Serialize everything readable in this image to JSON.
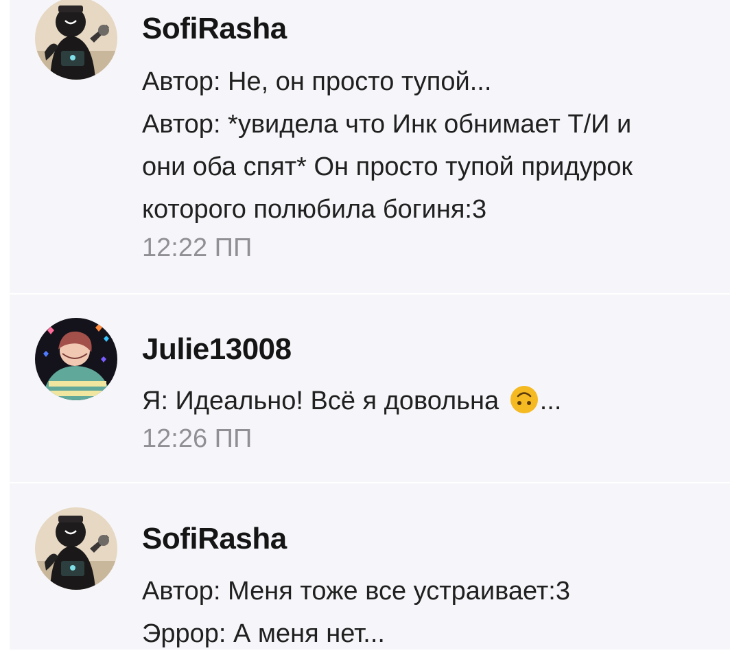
{
  "messages": [
    {
      "author": "SofiRasha",
      "lines": [
        "Автор: Не, он просто тупой...",
        "Автор: *увидела что Инк обнимает Т/И и",
        "они оба спят* Он просто тупой придурок",
        "которого полюбила богиня:3"
      ],
      "time": "12:22 ПП",
      "avatar": "sofirasha-avatar"
    },
    {
      "author": "Julie13008",
      "text_before_emoji": "Я: Идеально! Всё я довольна ",
      "emoji": "upside-down-face-icon",
      "text_after_emoji": "...",
      "time": "12:26 ПП",
      "avatar": "julie-avatar"
    },
    {
      "author": "SofiRasha",
      "lines": [
        "Автор: Меня тоже все устраивает:3",
        "Эррор: А меня нет..."
      ],
      "avatar": "sofirasha-avatar"
    }
  ],
  "colors": {
    "background": "#f6f5f9",
    "divider": "#ffffff",
    "author": "#151515",
    "text": "#202020",
    "time": "#8f8f94",
    "emoji": "#f5b921"
  }
}
